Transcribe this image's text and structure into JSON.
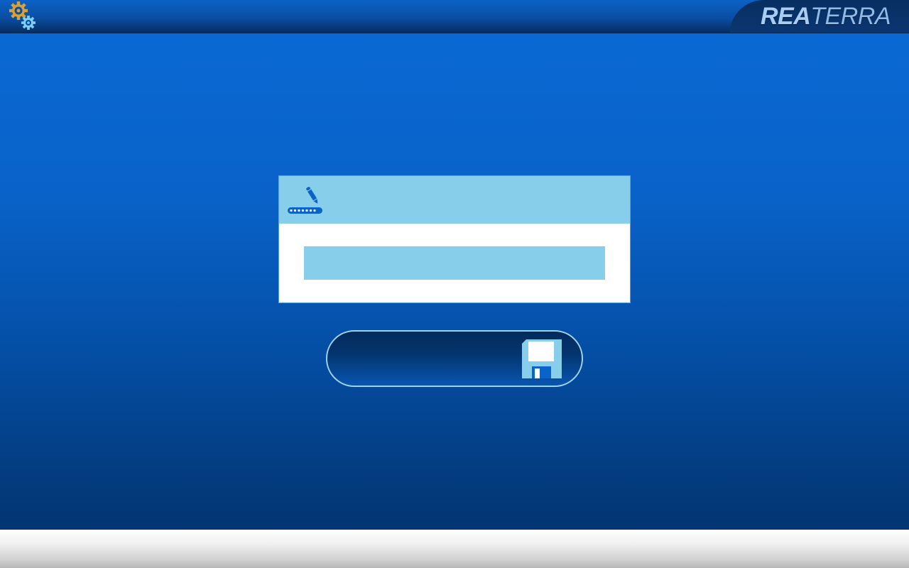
{
  "app": {
    "brand_part1": "REA",
    "brand_part2": "TERRA"
  },
  "icons": {
    "settings": "gears-icon",
    "password": "pen-password-icon",
    "save": "floppy-disk-icon"
  },
  "password_dialog": {
    "value": "",
    "placeholder": ""
  },
  "colors": {
    "background_top": "#0a6ad6",
    "background_bottom": "#023066",
    "panel_accent": "#87ceeb",
    "gear_gold": "#d9a034",
    "gear_blue": "#7fd0f5",
    "brand_text": "#9cc4ee"
  }
}
